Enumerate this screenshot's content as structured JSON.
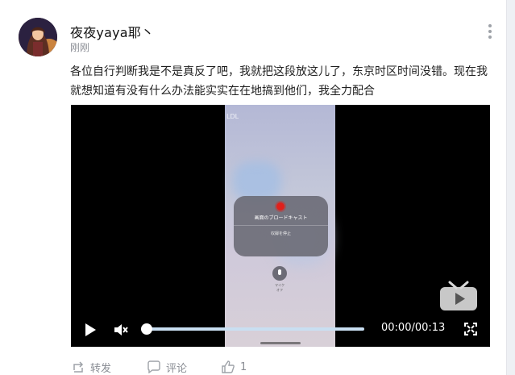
{
  "post": {
    "username": "夜夜yaya耶丶",
    "time": "刚刚",
    "text": "各位自行判断我是不是真反了吧，我就把这段放这儿了，东京时区时间没错。现在我就想知道有没有什么办法能实实在在地搞到他们，我全力配合"
  },
  "video": {
    "phone_status": "LDL",
    "broadcast_title": "画面のブロードキャスト",
    "broadcast_stop": "収録を停止",
    "mic_label": "マイク\nオフ",
    "progress": 0,
    "current_time": "00:00",
    "duration": "00:13",
    "timecode": "00:00/00:13"
  },
  "actions": {
    "repost": "转发",
    "comment": "评论",
    "like_count": "1"
  },
  "icons": [
    "more-icon",
    "play-icon",
    "mute-icon",
    "fullscreen-icon",
    "tv-icon",
    "repost-icon",
    "comment-icon",
    "like-icon"
  ],
  "colors": {
    "accent": "#8cc4ff",
    "text_secondary": "#8a8d94",
    "record_red": "#e0201c"
  }
}
